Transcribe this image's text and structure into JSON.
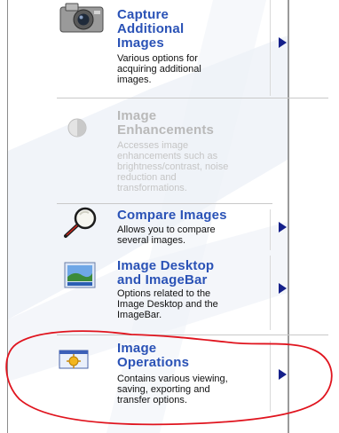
{
  "items": [
    {
      "title": "Capture Additional Images",
      "title_lines": [
        "Capture",
        "Additional",
        "Images"
      ],
      "description_lines": [
        "Various options for",
        "acquiring additional",
        "images."
      ],
      "icon": "camera-icon",
      "enabled": true
    },
    {
      "title": "Image Enhancements",
      "title_lines": [
        "Image",
        "Enhancements"
      ],
      "description_lines": [
        "Accesses image",
        "enhancements such as",
        "brightness/contrast, noise",
        "reduction and",
        "transformations."
      ],
      "icon": "enhancement-icon",
      "enabled": false
    },
    {
      "title": "Compare Images",
      "title_lines": [
        "Compare Images"
      ],
      "description_lines": [
        "Allows you to compare",
        "several images."
      ],
      "icon": "magnifier-icon",
      "enabled": true
    },
    {
      "title": "Image Desktop and ImageBar",
      "title_lines": [
        "Image Desktop",
        "and ImageBar"
      ],
      "description_lines": [
        "Options related to the",
        "Image Desktop and the",
        "ImageBar."
      ],
      "icon": "desktop-image-icon",
      "enabled": true
    },
    {
      "title": "Image Operations",
      "title_lines": [
        "Image",
        "Operations"
      ],
      "description_lines": [
        "Contains various viewing,",
        "saving, exporting and",
        "transfer options."
      ],
      "icon": "operations-icon",
      "enabled": true
    }
  ],
  "colors": {
    "title_blue": "#2a52b6",
    "arrow": "#15208a",
    "annotation_red": "#e0141e",
    "disabled_text": "#b9b9b9"
  }
}
